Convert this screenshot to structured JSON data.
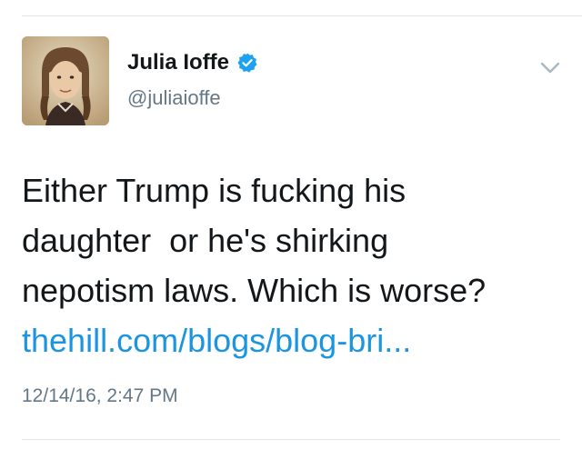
{
  "tweet": {
    "author": {
      "display_name": "Julia Ioffe",
      "handle": "@juliaioffe",
      "verified": true
    },
    "text_lines": [
      "Either Trump is fucking his",
      "daughter  or he's shirking",
      "nepotism laws. Which is worse?"
    ],
    "link_text": "thehill.com/blogs/blog-bri...",
    "timestamp": "12/14/16, 2:47 PM"
  },
  "icons": {
    "verified": "verified-badge-icon",
    "menu": "chevron-down-icon"
  },
  "colors": {
    "link": "#1b95e0",
    "verified": "#1da1f2",
    "secondary_text": "#657786",
    "primary_text": "#14171a",
    "divider": "#e1e8ed"
  }
}
